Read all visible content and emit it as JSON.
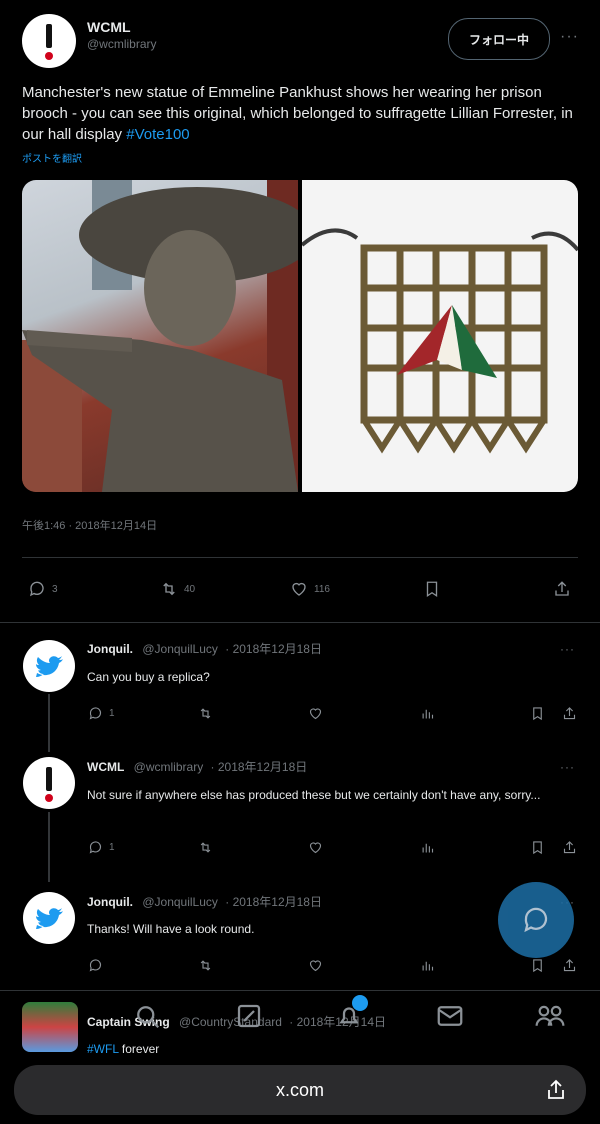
{
  "tweet": {
    "name": "WCML",
    "handle": "@wcmlibrary",
    "follow_label": "フォロー中",
    "more": "···",
    "text": "Manchester's new statue of Emmeline Pankhust shows her wearing her prison brooch - you can see this original, which belonged to suffragette Lillian Forrester, in our hall display ",
    "hashtag": "#Vote100",
    "translate": "ポストを翻訳",
    "timestamp": "午後1:46 · 2018年12月14日",
    "counts": {
      "replies": "3",
      "retweets": "40",
      "likes": "116"
    }
  },
  "replies": [
    {
      "name": "Jonquil.",
      "handle": "@JonquilLucy",
      "date": "· 2018年12月18日",
      "text": "Can you buy a replica?",
      "replies": "1",
      "avatar": "twitter-bird-icon"
    },
    {
      "name": "WCML",
      "handle": "@wcmlibrary",
      "date": "· 2018年12月18日",
      "text": "Not sure if anywhere else has produced these but we certainly don't have any, sorry...",
      "replies": "1",
      "avatar": "exclamation-icon"
    },
    {
      "name": "Jonquil.",
      "handle": "@JonquilLucy",
      "date": "· 2018年12月18日",
      "text": "Thanks! Will have a look round.",
      "replies": "",
      "avatar": "twitter-bird-icon"
    },
    {
      "name": "Captain Swing",
      "handle": "@CountryStandard",
      "date": "· 2018年12月14日",
      "text_hashtag": "#WFL",
      "text": " forever"
    }
  ],
  "browser": {
    "url": "x.com"
  },
  "colors": {
    "accent": "#1d9bf0",
    "muted": "#71767b",
    "bg": "#000000"
  }
}
